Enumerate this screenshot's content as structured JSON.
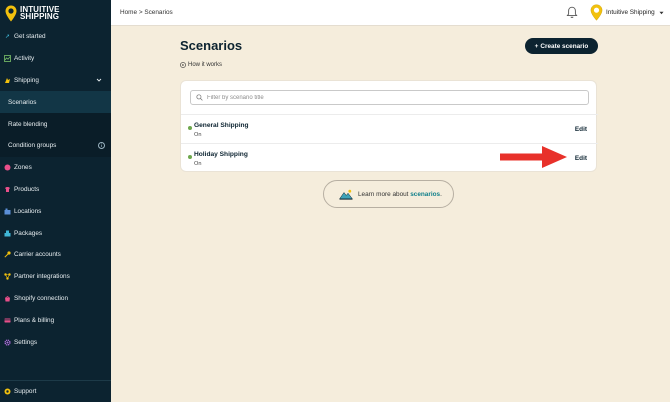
{
  "brand": {
    "line1": "INTUITIVE",
    "line2": "SHIPPING"
  },
  "sidebar": {
    "items": [
      {
        "label": "Get started",
        "icon": "rocket-icon"
      },
      {
        "label": "Activity",
        "icon": "activity-icon"
      },
      {
        "label": "Shipping",
        "icon": "shipping-icon"
      },
      {
        "label": "Scenarios"
      },
      {
        "label": "Rate blending"
      },
      {
        "label": "Condition groups"
      },
      {
        "label": "Zones",
        "icon": "zones-icon"
      },
      {
        "label": "Products",
        "icon": "products-icon"
      },
      {
        "label": "Locations",
        "icon": "locations-icon"
      },
      {
        "label": "Packages",
        "icon": "packages-icon"
      },
      {
        "label": "Carrier accounts",
        "icon": "key-icon"
      },
      {
        "label": "Partner integrations",
        "icon": "integrations-icon"
      },
      {
        "label": "Shopify connection",
        "icon": "shopify-icon"
      },
      {
        "label": "Plans & billing",
        "icon": "billing-icon"
      },
      {
        "label": "Settings",
        "icon": "gear-icon"
      }
    ],
    "support_label": "Support",
    "info_glyph": "i"
  },
  "topbar": {
    "breadcrumb": "Home > Scenarios",
    "user_name": "Intuitive Shipping"
  },
  "page": {
    "title": "Scenarios",
    "create_label": "Create scenario",
    "how_it_works": "How it works"
  },
  "search": {
    "placeholder": "Filter by scenario title",
    "value": ""
  },
  "scenarios": [
    {
      "title": "General Shipping",
      "status": "On",
      "edit_label": "Edit"
    },
    {
      "title": "Holiday Shipping",
      "status": "On",
      "edit_label": "Edit"
    }
  ],
  "learn": {
    "prefix": "Learn more about",
    "link": "scenarios",
    "suffix": "."
  },
  "colors": {
    "sidebar_bg": "#0c2330",
    "page_bg": "#f5eddc",
    "accent_yellow": "#f2c10d",
    "status_on": "#6ea84d",
    "annotation_arrow": "#e8312a",
    "link_teal": "#0f7f8a"
  }
}
